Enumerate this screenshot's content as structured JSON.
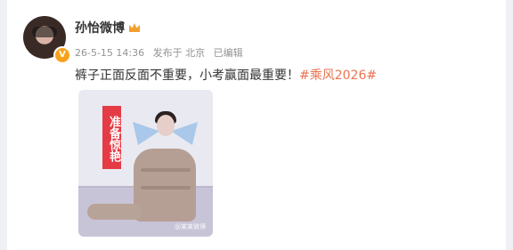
{
  "post": {
    "author": "孙怡微博",
    "timestamp": "26-5-15 14:36",
    "source": "发布于 北京",
    "edited": "已编辑",
    "text": "裤子正面反面不重要，小考赢面最重要！",
    "hashtag": "#乘风2026#"
  },
  "media": {
    "sign_text": "准备惊艳",
    "watermark": "@某某微博"
  },
  "colors": {
    "hashtag": "#eb7350",
    "verified_badge": "#f7a21b",
    "sign": "#e43b45"
  },
  "icons": {
    "avatar": "avatar",
    "verified": "verified-badge-icon",
    "crown": "crown-icon"
  }
}
